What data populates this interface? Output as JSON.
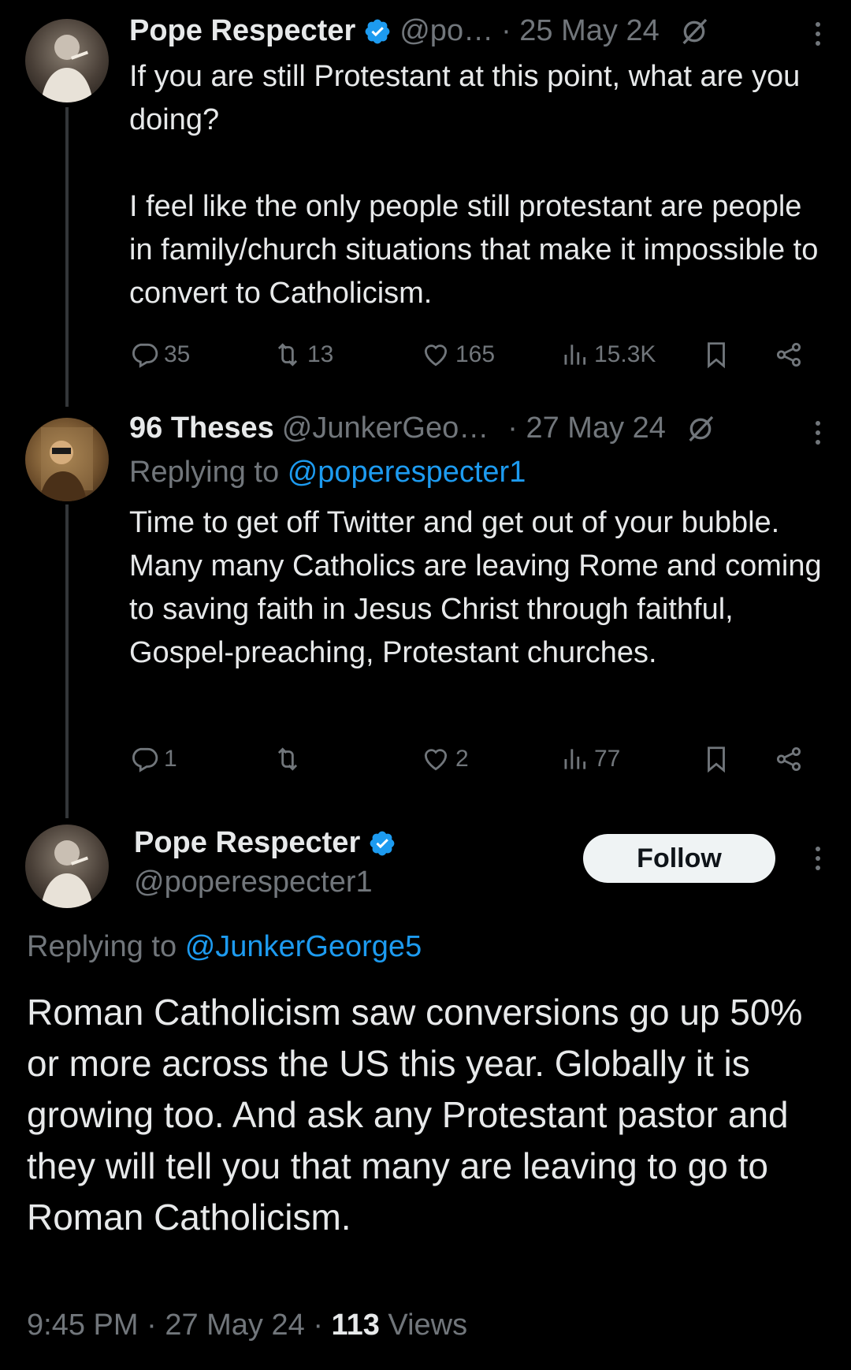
{
  "tweet1": {
    "name": "Pope Respecter",
    "handle": "@po…",
    "date": "· 25 May 24",
    "text": "If you are still Protestant at this point, what are you doing?\n\nI feel like the only people still protestant are people in family/church situations that make it impossible to convert to Catholicism.",
    "replies": "35",
    "reposts": "13",
    "likes": "165",
    "views": "15.3K"
  },
  "tweet2": {
    "name": "96 Theses",
    "handle": "@JunkerGeo…",
    "date": "· 27 May 24",
    "replying_prefix": "Replying to",
    "replying_to": "@poperespecter1",
    "text": "Time to get off Twitter and get out of your bubble. Many many Catholics are leaving Rome and coming to saving faith in Jesus Christ through faithful, Gospel-preaching, Protestant churches.",
    "replies": "1",
    "reposts": "",
    "likes": "2",
    "views": "77"
  },
  "tweet3": {
    "name": "Pope Respecter",
    "handle": "@poperespecter1",
    "follow_label": "Follow",
    "replying_prefix": "Replying to",
    "replying_to": "@JunkerGeorge5",
    "text": "Roman Catholicism saw conversions go up 50% or more across the US this year. Globally it is growing too. And ask any Protestant pastor and they will tell you that many are leaving to go to Roman Catholicism.",
    "time": "9:45 PM",
    "date": "27 May 24",
    "views_count": "113",
    "views_label": "Views"
  },
  "colors": {
    "background": "#000000",
    "text": "#e7e9ea",
    "muted": "#71767b",
    "link": "#1d9bf0",
    "verified": "#1d9bf0"
  },
  "icons": [
    "verified-icon",
    "grok-icon",
    "more-icon",
    "reply-icon",
    "repost-icon",
    "like-icon",
    "views-icon",
    "bookmark-icon",
    "share-icon"
  ]
}
